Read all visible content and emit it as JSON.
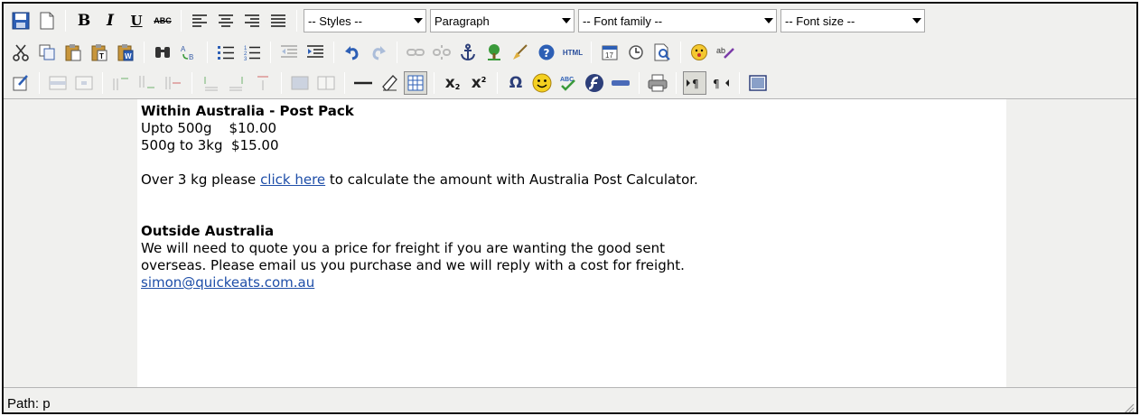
{
  "toolbar": {
    "row1": {
      "save": {
        "icon": "save-icon"
      },
      "new_document": {
        "icon": "new-document-icon"
      },
      "bold_label": "B",
      "italic_label": "I",
      "underline_label": "U",
      "strikethrough_label": "ABC",
      "align": [
        "align-left-icon",
        "align-center-icon",
        "align-right-icon",
        "align-justify-icon"
      ],
      "styles_select": "-- Styles --",
      "format_select": "Paragraph",
      "font_family_select": "-- Font family --",
      "font_size_select": "-- Font size --"
    },
    "row2": {
      "buttons": [
        "cut-icon",
        "copy-icon",
        "paste-icon",
        "paste-text-icon",
        "paste-word-icon",
        "find-icon",
        "replace-icon",
        "bullet-list-icon",
        "numbered-list-icon",
        "outdent-icon",
        "indent-icon",
        "undo-icon",
        "redo-icon",
        "link-icon",
        "unlink-icon",
        "anchor-icon",
        "image-icon",
        "cleanup-icon",
        "help-icon",
        "html-icon",
        "insert-date-icon",
        "insert-time-icon",
        "preview-icon",
        "emoticons-icon",
        "spellchecker-icon"
      ],
      "html_label": "HTML"
    },
    "row3": {
      "buttons": [
        "edit-css-icon",
        "table-row-props-icon",
        "table-cell-props-icon",
        "row-before-icon",
        "row-after-icon",
        "delete-row-icon",
        "col-before-icon",
        "col-after-icon",
        "delete-col-icon",
        "merge-cells-icon",
        "split-cells-icon",
        "horizontal-rule-icon",
        "remove-format-icon",
        "visual-aid-icon",
        "subscript-icon",
        "superscript-icon",
        "special-char-icon",
        "smiley-icon",
        "spellcheck-icon",
        "flash-icon",
        "advanced-hr-icon",
        "print-icon",
        "ltr-icon",
        "rtl-icon",
        "fullscreen-icon"
      ],
      "subscript_label": "x",
      "superscript_label": "x",
      "omega_label": "Ω"
    }
  },
  "content": {
    "heading1": "Within Australia - Post Pack",
    "line1": "Upto 500g    $10.00",
    "line2": "500g to 3kg  $15.00",
    "para_before_link": "Over 3 kg please ",
    "link_text": "click here",
    "para_after_link": " to calculate the amount with Australia Post Calculator.",
    "heading2": "Outside Australia",
    "para2_line1": "We will need to quote you a price for freight if you are wanting the good sent",
    "para2_line2": "overseas. Please email us you purchase and we will reply with a cost for freight.",
    "email": "simon@quickeats.com.au"
  },
  "status": {
    "path": "Path: p"
  },
  "colors": {
    "toolbar_bg": "#f0f0ee",
    "link": "#1e4ea8",
    "border": "#111111"
  }
}
